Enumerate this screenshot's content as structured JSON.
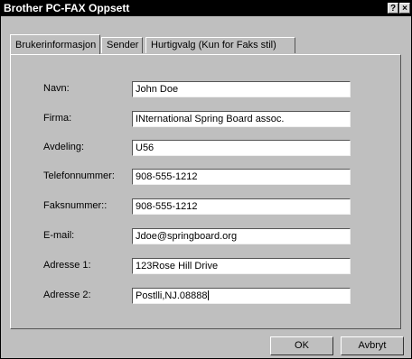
{
  "window": {
    "title": "Brother PC-FAX Oppsett",
    "help_button": "?",
    "close_button": "×"
  },
  "tabs": [
    {
      "label": "Brukerinformasjon",
      "active": true
    },
    {
      "label": "Sender",
      "active": false
    },
    {
      "label": "Hurtigvalg (Kun for Faks stil)",
      "active": false
    }
  ],
  "form": {
    "fields": [
      {
        "label": "Navn:",
        "value": "John Doe"
      },
      {
        "label": "Firma:",
        "value": "INternational Spring Board assoc."
      },
      {
        "label": "Avdeling:",
        "value": "U56"
      },
      {
        "label": "Telefonnummer:",
        "value": "908-555-1212"
      },
      {
        "label": "Faksnummer::",
        "value": "908-555-1212"
      },
      {
        "label": "E-mail:",
        "value": "Jdoe@springboard.org"
      },
      {
        "label": "Adresse 1:",
        "value": "123Rose Hill Drive"
      },
      {
        "label": "Adresse 2:",
        "value": "Postlli,NJ.08888"
      }
    ]
  },
  "buttons": {
    "ok": "OK",
    "cancel": "Avbryt"
  }
}
